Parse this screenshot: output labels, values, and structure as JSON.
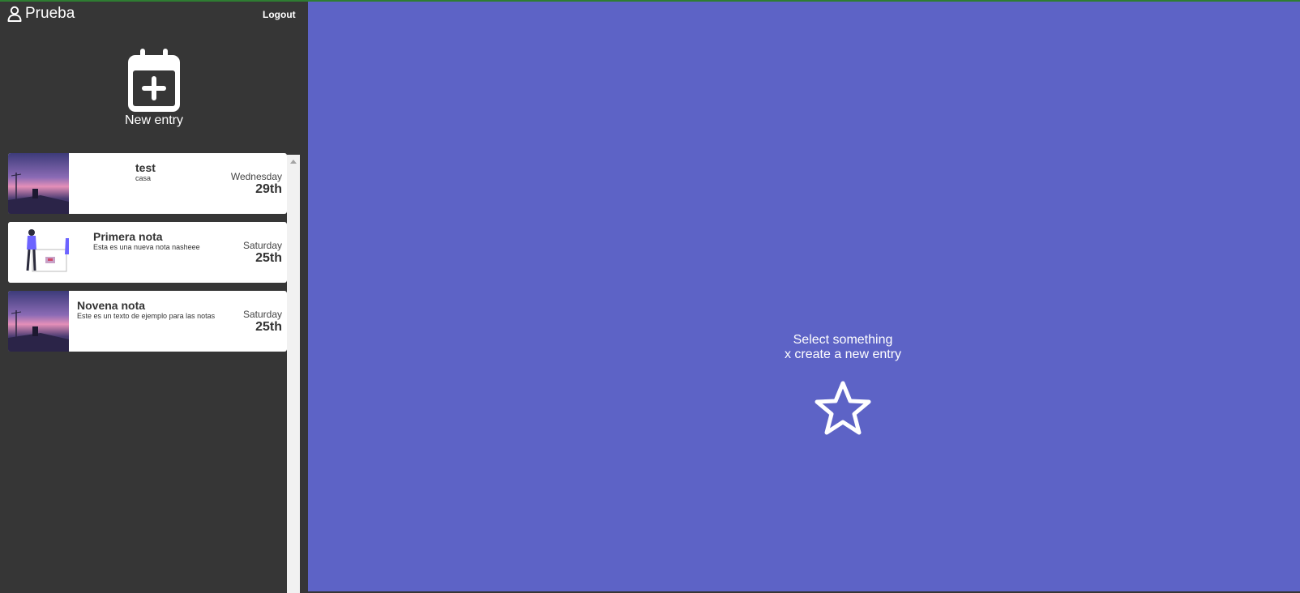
{
  "header": {
    "user_name": "Prueba",
    "logout_label": "Logout"
  },
  "sidebar": {
    "new_entry_label": "New entry"
  },
  "entries": [
    {
      "title": "test",
      "body": "casa",
      "day": "Wednesday",
      "date": "29th",
      "thumbnail": "night-sky-photo"
    },
    {
      "title": "Primera nota",
      "body": "Esta es una nueva nota nasheee",
      "day": "Saturday",
      "date": "25th",
      "thumbnail": "presentation-illustration"
    },
    {
      "title": "Novena nota",
      "body": "Este es un texto de ejemplo para las notas",
      "day": "Saturday",
      "date": "25th",
      "thumbnail": "night-sky-photo"
    }
  ],
  "main": {
    "empty_line1": "Select something",
    "empty_line2": "x create a new entry"
  },
  "colors": {
    "sidebar_bg": "#363636",
    "main_bg": "#5d63c6",
    "accent_bar": "#2e7d32",
    "card_bg": "#ffffff"
  }
}
